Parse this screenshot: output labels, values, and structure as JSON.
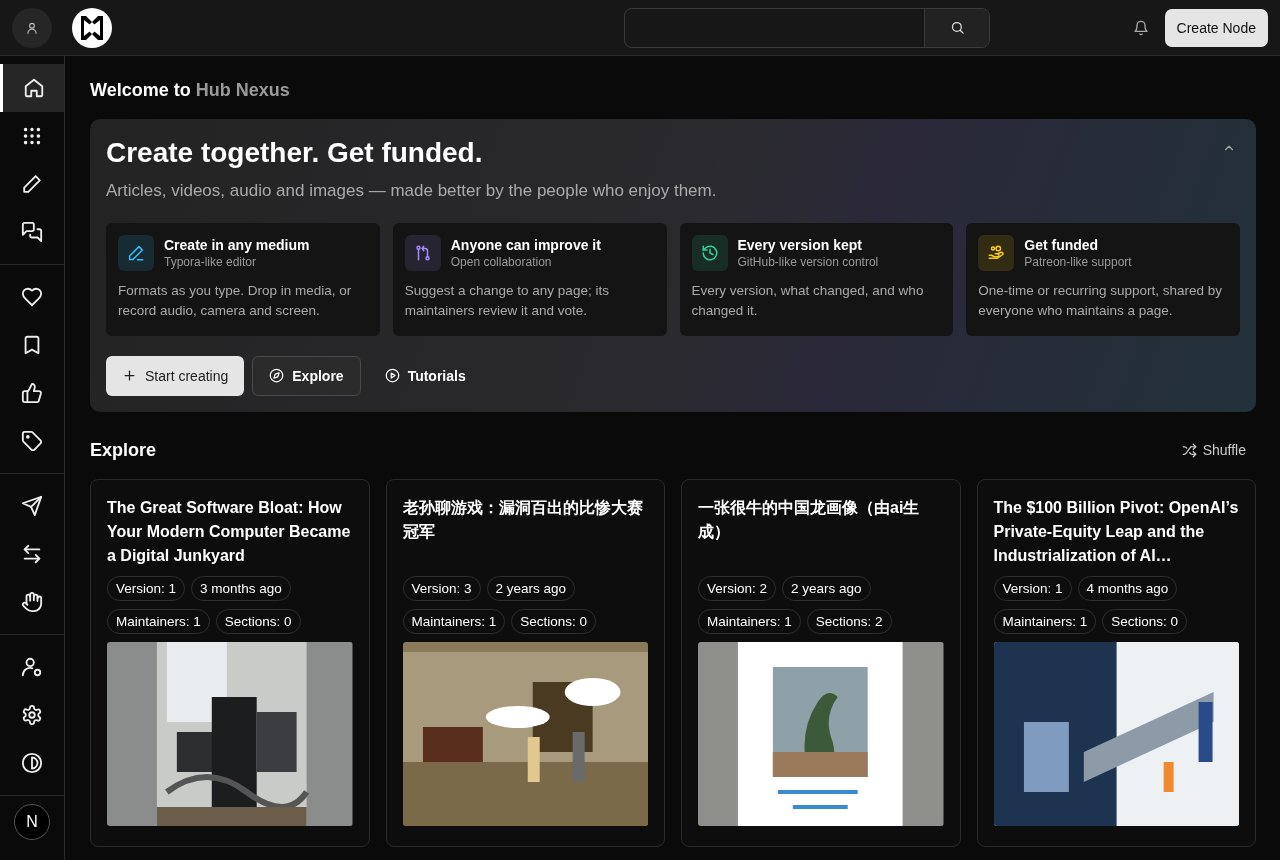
{
  "topbar": {
    "create_button": "Create Node"
  },
  "sidebar": {
    "groups": [
      {
        "items": [
          {
            "selected": true
          },
          {
            "selected": false
          },
          {
            "selected": false
          },
          {
            "selected": false
          }
        ]
      },
      {
        "items": [
          {
            "selected": false
          },
          {
            "selected": false
          },
          {
            "selected": false
          },
          {
            "selected": false
          }
        ]
      },
      {
        "items": [
          {
            "selected": false
          },
          {
            "selected": false
          },
          {
            "selected": false
          }
        ]
      },
      {
        "items": [
          {
            "selected": false
          },
          {
            "selected": false
          },
          {
            "selected": false
          }
        ]
      }
    ],
    "avatar_initial": "N"
  },
  "welcome": {
    "prefix": "Welcome to",
    "name": "Hub Nexus"
  },
  "hero": {
    "title": "Create together. Get funded.",
    "subtitle": "Articles, videos, audio and images — made better by the people who enjoy them.",
    "expanded": true,
    "features": [
      {
        "title": "Create in any medium",
        "subtitle": "Typora-like editor",
        "description": "Formats as you type. Drop in media, or record audio, camera and screen.",
        "color": "#38bdf8"
      },
      {
        "title": "Anyone can improve it",
        "subtitle": "Open collaboration",
        "description": "Suggest a change to any page; its maintainers review it and vote.",
        "color": "#a78bfa"
      },
      {
        "title": "Every version kept",
        "subtitle": "GitHub-like version control",
        "description": "Every version, what changed, and who changed it.",
        "color": "#34d399"
      },
      {
        "title": "Get funded",
        "subtitle": "Patreon-like support",
        "description": "One-time or recurring support, shared by everyone who maintains a page.",
        "color": "#facc15"
      }
    ],
    "buttons": [
      {
        "label": "Start creating",
        "kind": "primary"
      },
      {
        "label": "Explore",
        "kind": "outline"
      },
      {
        "label": "Tutorials",
        "kind": "ghost"
      }
    ]
  },
  "explore": {
    "title": "Explore",
    "shuffle": "Shuffle",
    "cards": [
      {
        "title": "The Great Software Bloat: How Your Modern Computer Became a Digital Junkyard",
        "version": "Version: 1",
        "age": "3 months ago",
        "maintainers": "Maintainers: 1",
        "sections": "Sections: 0"
      },
      {
        "title": "老孙聊游戏：漏洞百出的比惨大赛冠军",
        "version": "Version: 3",
        "age": "2 years ago",
        "maintainers": "Maintainers: 1",
        "sections": "Sections: 0"
      },
      {
        "title": "一张很牛的中国龙画像（由ai生成）",
        "version": "Version: 2",
        "age": "2 years ago",
        "maintainers": "Maintainers: 1",
        "sections": "Sections: 2"
      },
      {
        "title": "The $100 Billion Pivot: OpenAI’s Private-Equity Leap and the Industrialization of AI…",
        "version": "Version: 1",
        "age": "4 months ago",
        "maintainers": "Maintainers: 1",
        "sections": "Sections: 0"
      }
    ]
  }
}
